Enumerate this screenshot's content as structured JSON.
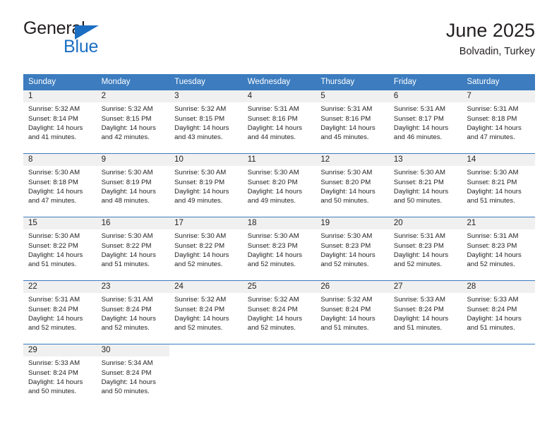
{
  "brand": {
    "name_top": "General",
    "name_bottom": "Blue",
    "triangle_color": "#1b6ec2",
    "accent_color": "#3c7cbf"
  },
  "header": {
    "title": "June 2025",
    "subtitle": "Bolvadin, Turkey"
  },
  "calendar": {
    "day_headers": [
      "Sunday",
      "Monday",
      "Tuesday",
      "Wednesday",
      "Thursday",
      "Friday",
      "Saturday"
    ],
    "labels": {
      "sunrise": "Sunrise:",
      "sunset": "Sunset:",
      "daylight": "Daylight:"
    },
    "weeks": [
      [
        {
          "day": "1",
          "sunrise": "Sunrise: 5:32 AM",
          "sunset": "Sunset: 8:14 PM",
          "daylight": "Daylight: 14 hours and 41 minutes."
        },
        {
          "day": "2",
          "sunrise": "Sunrise: 5:32 AM",
          "sunset": "Sunset: 8:15 PM",
          "daylight": "Daylight: 14 hours and 42 minutes."
        },
        {
          "day": "3",
          "sunrise": "Sunrise: 5:32 AM",
          "sunset": "Sunset: 8:15 PM",
          "daylight": "Daylight: 14 hours and 43 minutes."
        },
        {
          "day": "4",
          "sunrise": "Sunrise: 5:31 AM",
          "sunset": "Sunset: 8:16 PM",
          "daylight": "Daylight: 14 hours and 44 minutes."
        },
        {
          "day": "5",
          "sunrise": "Sunrise: 5:31 AM",
          "sunset": "Sunset: 8:16 PM",
          "daylight": "Daylight: 14 hours and 45 minutes."
        },
        {
          "day": "6",
          "sunrise": "Sunrise: 5:31 AM",
          "sunset": "Sunset: 8:17 PM",
          "daylight": "Daylight: 14 hours and 46 minutes."
        },
        {
          "day": "7",
          "sunrise": "Sunrise: 5:31 AM",
          "sunset": "Sunset: 8:18 PM",
          "daylight": "Daylight: 14 hours and 47 minutes."
        }
      ],
      [
        {
          "day": "8",
          "sunrise": "Sunrise: 5:30 AM",
          "sunset": "Sunset: 8:18 PM",
          "daylight": "Daylight: 14 hours and 47 minutes."
        },
        {
          "day": "9",
          "sunrise": "Sunrise: 5:30 AM",
          "sunset": "Sunset: 8:19 PM",
          "daylight": "Daylight: 14 hours and 48 minutes."
        },
        {
          "day": "10",
          "sunrise": "Sunrise: 5:30 AM",
          "sunset": "Sunset: 8:19 PM",
          "daylight": "Daylight: 14 hours and 49 minutes."
        },
        {
          "day": "11",
          "sunrise": "Sunrise: 5:30 AM",
          "sunset": "Sunset: 8:20 PM",
          "daylight": "Daylight: 14 hours and 49 minutes."
        },
        {
          "day": "12",
          "sunrise": "Sunrise: 5:30 AM",
          "sunset": "Sunset: 8:20 PM",
          "daylight": "Daylight: 14 hours and 50 minutes."
        },
        {
          "day": "13",
          "sunrise": "Sunrise: 5:30 AM",
          "sunset": "Sunset: 8:21 PM",
          "daylight": "Daylight: 14 hours and 50 minutes."
        },
        {
          "day": "14",
          "sunrise": "Sunrise: 5:30 AM",
          "sunset": "Sunset: 8:21 PM",
          "daylight": "Daylight: 14 hours and 51 minutes."
        }
      ],
      [
        {
          "day": "15",
          "sunrise": "Sunrise: 5:30 AM",
          "sunset": "Sunset: 8:22 PM",
          "daylight": "Daylight: 14 hours and 51 minutes."
        },
        {
          "day": "16",
          "sunrise": "Sunrise: 5:30 AM",
          "sunset": "Sunset: 8:22 PM",
          "daylight": "Daylight: 14 hours and 51 minutes."
        },
        {
          "day": "17",
          "sunrise": "Sunrise: 5:30 AM",
          "sunset": "Sunset: 8:22 PM",
          "daylight": "Daylight: 14 hours and 52 minutes."
        },
        {
          "day": "18",
          "sunrise": "Sunrise: 5:30 AM",
          "sunset": "Sunset: 8:23 PM",
          "daylight": "Daylight: 14 hours and 52 minutes."
        },
        {
          "day": "19",
          "sunrise": "Sunrise: 5:30 AM",
          "sunset": "Sunset: 8:23 PM",
          "daylight": "Daylight: 14 hours and 52 minutes."
        },
        {
          "day": "20",
          "sunrise": "Sunrise: 5:31 AM",
          "sunset": "Sunset: 8:23 PM",
          "daylight": "Daylight: 14 hours and 52 minutes."
        },
        {
          "day": "21",
          "sunrise": "Sunrise: 5:31 AM",
          "sunset": "Sunset: 8:23 PM",
          "daylight": "Daylight: 14 hours and 52 minutes."
        }
      ],
      [
        {
          "day": "22",
          "sunrise": "Sunrise: 5:31 AM",
          "sunset": "Sunset: 8:24 PM",
          "daylight": "Daylight: 14 hours and 52 minutes."
        },
        {
          "day": "23",
          "sunrise": "Sunrise: 5:31 AM",
          "sunset": "Sunset: 8:24 PM",
          "daylight": "Daylight: 14 hours and 52 minutes."
        },
        {
          "day": "24",
          "sunrise": "Sunrise: 5:32 AM",
          "sunset": "Sunset: 8:24 PM",
          "daylight": "Daylight: 14 hours and 52 minutes."
        },
        {
          "day": "25",
          "sunrise": "Sunrise: 5:32 AM",
          "sunset": "Sunset: 8:24 PM",
          "daylight": "Daylight: 14 hours and 52 minutes."
        },
        {
          "day": "26",
          "sunrise": "Sunrise: 5:32 AM",
          "sunset": "Sunset: 8:24 PM",
          "daylight": "Daylight: 14 hours and 51 minutes."
        },
        {
          "day": "27",
          "sunrise": "Sunrise: 5:33 AM",
          "sunset": "Sunset: 8:24 PM",
          "daylight": "Daylight: 14 hours and 51 minutes."
        },
        {
          "day": "28",
          "sunrise": "Sunrise: 5:33 AM",
          "sunset": "Sunset: 8:24 PM",
          "daylight": "Daylight: 14 hours and 51 minutes."
        }
      ],
      [
        {
          "day": "29",
          "sunrise": "Sunrise: 5:33 AM",
          "sunset": "Sunset: 8:24 PM",
          "daylight": "Daylight: 14 hours and 50 minutes."
        },
        {
          "day": "30",
          "sunrise": "Sunrise: 5:34 AM",
          "sunset": "Sunset: 8:24 PM",
          "daylight": "Daylight: 14 hours and 50 minutes."
        },
        {
          "day": "",
          "sunrise": "",
          "sunset": "",
          "daylight": ""
        },
        {
          "day": "",
          "sunrise": "",
          "sunset": "",
          "daylight": ""
        },
        {
          "day": "",
          "sunrise": "",
          "sunset": "",
          "daylight": ""
        },
        {
          "day": "",
          "sunrise": "",
          "sunset": "",
          "daylight": ""
        },
        {
          "day": "",
          "sunrise": "",
          "sunset": "",
          "daylight": ""
        }
      ]
    ]
  }
}
